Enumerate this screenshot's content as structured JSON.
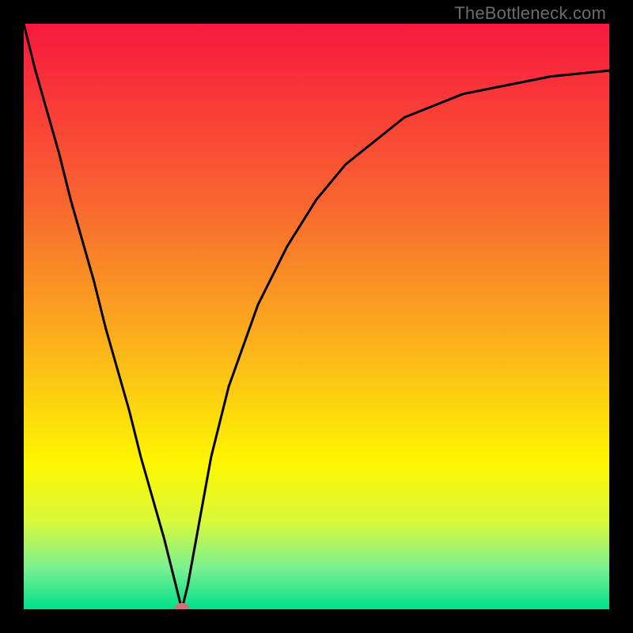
{
  "watermark": "TheBottleneck.com",
  "chart_data": {
    "type": "line",
    "title": "",
    "xlabel": "",
    "ylabel": "",
    "x": [
      0,
      2,
      4,
      6,
      8,
      10,
      12,
      14,
      16,
      18,
      20,
      22,
      24,
      26,
      27,
      28,
      30,
      32,
      35,
      40,
      45,
      50,
      55,
      60,
      65,
      70,
      75,
      80,
      85,
      90,
      95,
      100
    ],
    "values": [
      100,
      92,
      85,
      78,
      70,
      63,
      56,
      48,
      41,
      34,
      26,
      19,
      12,
      4,
      0,
      4,
      15,
      26,
      38,
      52,
      62,
      70,
      76,
      80,
      84,
      86,
      88,
      89,
      90,
      91,
      91.5,
      92
    ],
    "xlim": [
      0,
      100
    ],
    "ylim": [
      0,
      100
    ],
    "minimum_point": {
      "x": 27,
      "y": 0
    },
    "gradient_stops": [
      {
        "pos": 0.0,
        "color": "#f8183e"
      },
      {
        "pos": 0.3,
        "color": "#f86430"
      },
      {
        "pos": 0.55,
        "color": "#fbb31c"
      },
      {
        "pos": 0.75,
        "color": "#fef600"
      },
      {
        "pos": 0.85,
        "color": "#d9f93b"
      },
      {
        "pos": 0.93,
        "color": "#7af091"
      },
      {
        "pos": 1.0,
        "color": "#00e08a"
      }
    ],
    "marker": {
      "color": "#d16f78"
    }
  }
}
